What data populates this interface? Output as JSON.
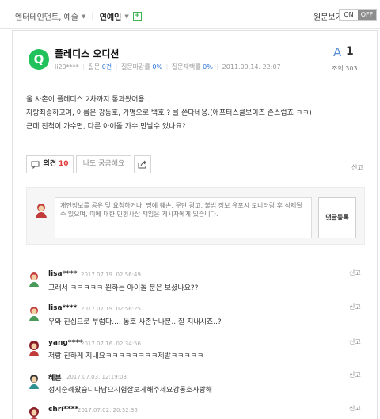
{
  "topbar": {
    "category": "엔터테인먼트, 예술",
    "subcategory": "연예인",
    "plus": "+",
    "original_view_label": "원문보기",
    "toggle_on": "ON",
    "toggle_off": "OFF"
  },
  "question": {
    "logo": "Q",
    "title": "플레디스 오디션",
    "author": "li20****",
    "label_questions": "질문",
    "questions_value": "0건",
    "label_deadline_rate": "질문마감률",
    "deadline_rate": "0%",
    "label_rerate": "질문재택률",
    "rerate": "0%",
    "timestamp": "2011.09.14. 22:07",
    "answer_letter": "A",
    "answer_count": "1",
    "views_label": "조회",
    "views": "303",
    "body": [
      "울 사촌이 플레디스 2차까지 통과됬어용..",
      "자랑죄송하고여, 이름은 강동호, 가명으로 백호 ? 를 쓴다네용.(애프터스쿨보이즈 존스럽죠 ㅋㅋ)",
      "근데 친척이 가수면, 다른 아이돌 가수 만날수 있나요?"
    ]
  },
  "actions": {
    "opinion_label": "의견",
    "opinion_count": "10",
    "curious_label": "나도 궁금해요",
    "report_label": "신고"
  },
  "comment_box": {
    "placeholder": "개인정보를 공유 및 요청하거나, 명예 훼손, 무단 광고, 불법 정보 유포시 모니터링 후 삭제될 수 있으며, 이에 대한 민형사상 책임은 게시자에게 있습니다.",
    "submit_label": "댓글등록"
  },
  "comments": [
    {
      "name": "lisa****",
      "date": "2017.07.19. 02:56:49",
      "text": "그래서 ㅋㅋㅋㅋㅋ 원하는 아이돌 분은 보셨나요??",
      "report": "신고"
    },
    {
      "name": "lisa****",
      "date": "2017.07.19. 02:56:25",
      "text": "우와 진심으로 부럽다.... 동호 사촌누나분.. 잘 지내시죠..?",
      "report": "신고"
    },
    {
      "name": "yang****",
      "date": "2017.07.16. 02:34:56",
      "text": "저랑 친하게 지내요ㅋㅋㅋㅋㅋㅋㅋㅋ제발ㅋㅋㅋㅋㅋ",
      "report": "신고"
    },
    {
      "name": "혜븐",
      "date": "2017.07.03. 12:19:03",
      "text": "성지순례왔습니다남으시험잘보게해주세요강동호사랑해",
      "report": "신고"
    },
    {
      "name": "chri****",
      "date": "2017.07.02. 20:32:35",
      "text": "",
      "report": "신고"
    }
  ]
}
